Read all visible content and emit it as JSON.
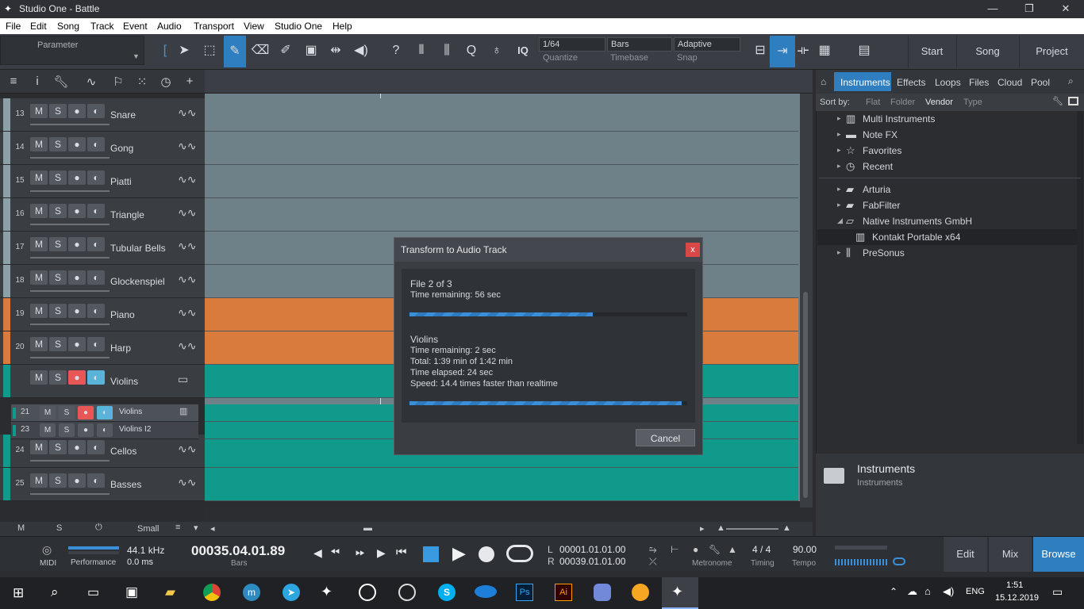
{
  "window": {
    "title": "Studio One - Battle"
  },
  "menu": [
    "File",
    "Edit",
    "Song",
    "Track",
    "Event",
    "Audio",
    "Transport",
    "View",
    "Studio One",
    "Help"
  ],
  "toolbar": {
    "parameter_label": "Parameter",
    "quantize": {
      "value": "1/64",
      "label": "Quantize"
    },
    "timebase": {
      "value": "Bars",
      "label": "Timebase"
    },
    "snap": {
      "value": "Adaptive",
      "label": "Snap"
    },
    "iq": "IQ",
    "nav": {
      "start": "Start",
      "song": "Song",
      "project": "Project"
    }
  },
  "tracks": [
    {
      "num": "13",
      "name": "Snare",
      "color": "#8ca0a8"
    },
    {
      "num": "14",
      "name": "Gong",
      "color": "#8ca0a8"
    },
    {
      "num": "15",
      "name": "Piatti",
      "color": "#8ca0a8"
    },
    {
      "num": "16",
      "name": "Triangle",
      "color": "#8ca0a8"
    },
    {
      "num": "17",
      "name": "Tubular Bells",
      "color": "#8ca0a8"
    },
    {
      "num": "18",
      "name": "Glockenspiel",
      "color": "#8ca0a8"
    },
    {
      "num": "19",
      "name": "Piano",
      "color": "#d97b3c"
    },
    {
      "num": "20",
      "name": "Harp",
      "color": "#d97b3c"
    },
    {
      "num": "",
      "name": "Violins",
      "color": "#0f9a8c",
      "folder": true
    },
    {
      "num": "24",
      "name": "Cellos",
      "color": "#0f9a8c"
    },
    {
      "num": "25",
      "name": "Basses",
      "color": "#0f9a8c"
    }
  ],
  "subtracks": [
    {
      "num": "21",
      "name": "Violins"
    },
    {
      "num": "23",
      "name": "Violins I2"
    }
  ],
  "track_buttons": {
    "m": "M",
    "s": "S"
  },
  "bottom": {
    "m": "M",
    "s": "S",
    "size": "Small"
  },
  "browser": {
    "tabs": [
      "Instruments",
      "Effects",
      "Loops",
      "Files",
      "Cloud",
      "Pool"
    ],
    "sort_by": "Sort by:",
    "sort_opts": [
      "Flat",
      "Folder",
      "Vendor",
      "Type"
    ],
    "items": [
      "Multi Instruments",
      "Note FX",
      "Favorites",
      "Recent",
      "Arturia",
      "FabFilter",
      "Native Instruments GmbH",
      "Kontakt Portable x64",
      "PreSonus"
    ],
    "info_title": "Instruments",
    "info_sub": "Instruments"
  },
  "dialog": {
    "title": "Transform to Audio Track",
    "close": "x",
    "file_line": "File 2 of 3",
    "time_remaining": "Time remaining:  56 sec",
    "overall_progress": 0.66,
    "track_name": "Violins",
    "track_remaining": "Time remaining:  2 sec",
    "total": "Total: 1:39 min of 1:42 min",
    "elapsed": "Time elapsed: 24 sec",
    "speed": "Speed: 14.4 times faster than realtime",
    "track_progress": 0.98,
    "cancel": "Cancel"
  },
  "transport": {
    "midi": "MIDI",
    "performance": "Performance",
    "samplerate": "44.1 kHz",
    "latency": "0.0 ms",
    "position": "00035.04.01.89",
    "position_unit": "Bars",
    "loop_l_label": "L",
    "loop_l": "00001.01.01.00",
    "loop_r_label": "R",
    "loop_r": "00039.01.01.00",
    "metronome": "Metronome",
    "timing_value": "4 / 4",
    "timing": "Timing",
    "tempo_value": "90.00",
    "tempo": "Tempo",
    "views": [
      "Edit",
      "Mix",
      "Browse"
    ]
  },
  "taskbar": {
    "lang": "ENG",
    "time": "1:51",
    "date": "15.12.2019"
  }
}
